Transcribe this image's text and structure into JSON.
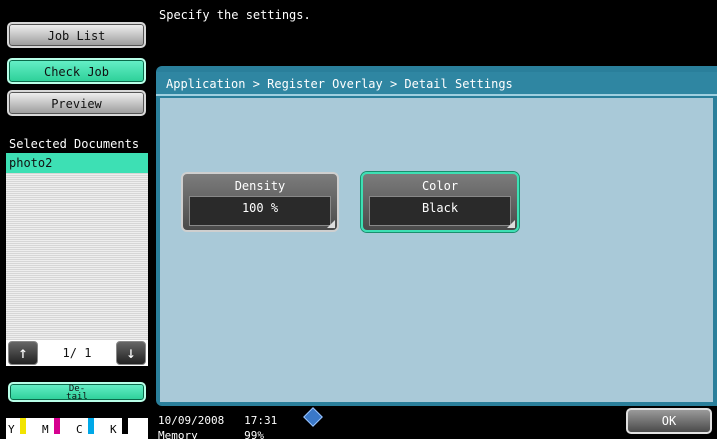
{
  "sidebar": {
    "job_list": "Job List",
    "check_job": "Check Job",
    "preview": "Preview",
    "selected_documents_header": "Selected Documents",
    "selected_documents": [
      "photo2"
    ],
    "page_indicator": "1/ 1",
    "detail_button": "De-\ntail",
    "toner": [
      "Y",
      "M",
      "C",
      "K"
    ]
  },
  "top_message": "Specify the settings.",
  "panel": {
    "breadcrumb": "Application > Register Overlay > Detail Settings",
    "density": {
      "label": "Density",
      "value": "100  %"
    },
    "color": {
      "label": "Color",
      "value": "Black"
    }
  },
  "status": {
    "datetime": "10/09/2008   17:31",
    "memory": "Memory       99%"
  },
  "ok_label": "OK",
  "colors": {
    "accent_green": "#3de0b4",
    "panel_blue": "#2a7f9b",
    "panel_body": "#a9c9d8",
    "toner_y": "#f2e400",
    "toner_m": "#d6008f",
    "toner_c": "#00a8e8",
    "toner_k": "#000000"
  }
}
